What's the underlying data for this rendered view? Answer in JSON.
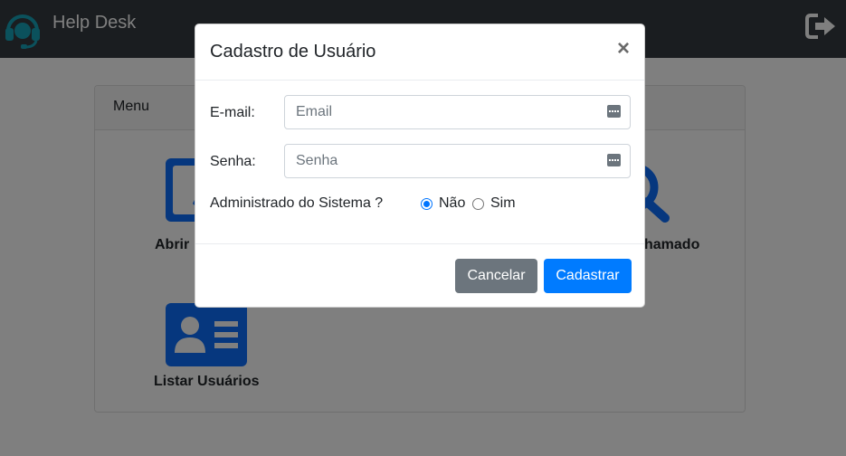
{
  "navbar": {
    "brand": "Help Desk",
    "brand_icon": "headset-icon",
    "logout_icon": "sign-out-icon"
  },
  "menu": {
    "header": "Menu",
    "tiles": [
      {
        "label": "Abrir",
        "icon": "abrir-chamado-icon"
      },
      {
        "label": "hamado",
        "icon": "search-icon"
      },
      {
        "label": "Listar Usuários",
        "icon": "id-card-icon"
      }
    ]
  },
  "modal": {
    "title": "Cadastro de Usuário",
    "close_glyph": "×",
    "email": {
      "label": "E-mail:",
      "placeholder": "Email"
    },
    "password": {
      "label": "Senha:",
      "placeholder": "Senha"
    },
    "admin": {
      "label": "Administrado do Sistema ?",
      "options": [
        {
          "label": "Não",
          "checked": true
        },
        {
          "label": "Sim",
          "checked": false
        }
      ]
    },
    "buttons": {
      "cancel": "Cancelar",
      "submit": "Cadastrar"
    }
  },
  "colors": {
    "navbar": "#343a40",
    "primary": "#007bff",
    "secondary": "#6c757d",
    "icon_blue": "#0d6efd"
  }
}
